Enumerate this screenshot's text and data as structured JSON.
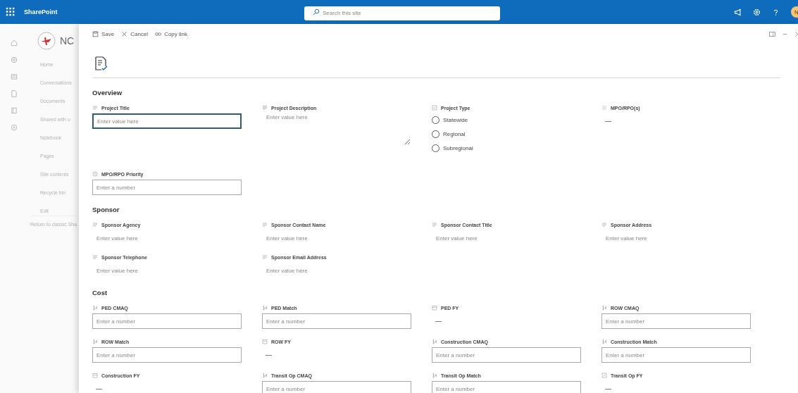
{
  "app": {
    "name": "SharePoint",
    "search": {
      "placeholder": "Search this site"
    },
    "avatar": "N"
  },
  "rail": [
    {
      "kind": "home"
    },
    {
      "kind": "sites"
    },
    {
      "kind": "news"
    },
    {
      "kind": "files"
    },
    {
      "kind": "notebook"
    },
    {
      "kind": "create"
    }
  ],
  "site": {
    "title": "NC",
    "nav": [
      "Home",
      "Conversations",
      "Documents",
      "Shared with u",
      "Notebook",
      "Pages",
      "Site contents",
      "Recycle bin",
      "Edit"
    ],
    "footer": "Return to classic Sha"
  },
  "commands": [
    {
      "kind": "save",
      "label": "Save"
    },
    {
      "kind": "cancel",
      "label": "Cancel"
    },
    {
      "kind": "link",
      "label": "Copy link"
    }
  ],
  "sections": [
    {
      "title": "Overview",
      "rows": [
        [
          {
            "label": "Project Title",
            "kind": "text",
            "placeholder": "Enter value here",
            "focused": true
          },
          {
            "label": "Project Description",
            "kind": "note",
            "placeholder": "Enter value here",
            "focused": false
          },
          {
            "label": "Project Type",
            "kind": "choice",
            "options": [
              {
                "label": "Statewide",
                "selected": false
              },
              {
                "label": "Regional",
                "selected": false
              },
              {
                "label": "Subregional",
                "selected": false
              }
            ]
          },
          {
            "label": "MPO/RPO(s)",
            "kind": "lookup",
            "value": "—"
          }
        ],
        [
          {
            "label": "MPO/RPO Priority",
            "kind": "number",
            "placeholder": "Enter a number",
            "focused": false
          }
        ]
      ]
    },
    {
      "title": "Sponsor",
      "rows": [
        [
          {
            "label": "Sponsor Agency",
            "kind": "text",
            "placeholder": "Enter value here",
            "focused": false
          },
          {
            "label": "Sponsor Contact Name",
            "kind": "text",
            "placeholder": "Enter value here",
            "focused": false
          },
          {
            "label": "Sponsor Contact Title",
            "kind": "text",
            "placeholder": "Enter value here",
            "focused": false
          },
          {
            "label": "Sponsor Address",
            "kind": "text",
            "placeholder": "Enter value here",
            "focused": false
          }
        ],
        [
          {
            "label": "Sponsor Telephone",
            "kind": "text",
            "placeholder": "Enter value here",
            "focused": false
          },
          {
            "label": "Sponsor Email Address",
            "kind": "text",
            "placeholder": "Enter value here",
            "focused": false
          }
        ]
      ]
    },
    {
      "title": "Cost",
      "rows": [
        [
          {
            "label": "PED CMAQ",
            "kind": "currency",
            "placeholder": "Enter a number",
            "focused": false
          },
          {
            "label": "PED Match",
            "kind": "currency",
            "placeholder": "Enter a number",
            "focused": false
          },
          {
            "label": "PED FY",
            "kind": "year",
            "value": "—"
          },
          {
            "label": "ROW CMAQ",
            "kind": "currency",
            "placeholder": "Enter a number",
            "focused": false
          }
        ],
        [
          {
            "label": "ROW Match",
            "kind": "currency",
            "placeholder": "Enter a number",
            "focused": false
          },
          {
            "label": "ROW FY",
            "kind": "year",
            "value": "—"
          },
          {
            "label": "Construction CMAQ",
            "kind": "currency",
            "placeholder": "Enter a number",
            "focused": false
          },
          {
            "label": "Construction Match",
            "kind": "currency",
            "placeholder": "Enter a number",
            "focused": false
          }
        ],
        [
          {
            "label": "Construction FY",
            "kind": "year",
            "value": "—"
          },
          {
            "label": "Transit Op CMAQ",
            "kind": "currency",
            "placeholder": "Enter a number",
            "focused": false
          },
          {
            "label": "Transit Op Match",
            "kind": "currency",
            "placeholder": "Enter a number",
            "focused": false
          },
          {
            "label": "Transit Op FY",
            "kind": "check",
            "value": "—"
          }
        ]
      ]
    }
  ]
}
